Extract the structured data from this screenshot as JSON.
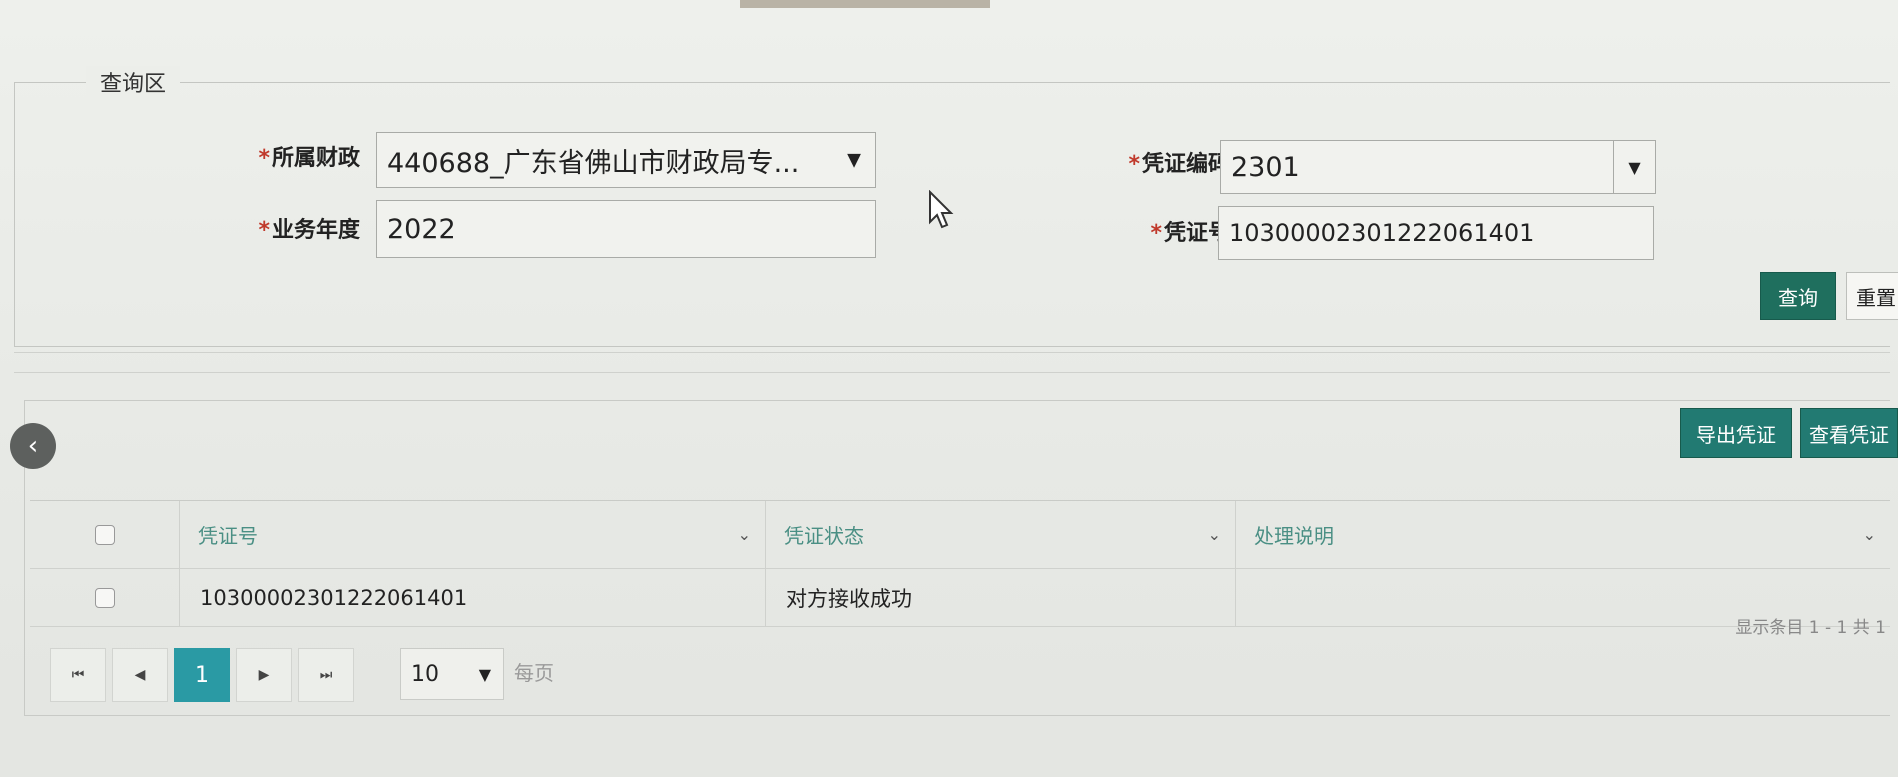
{
  "query_area": {
    "legend": "查询区",
    "fields": {
      "finance": {
        "required": "*",
        "label": "所属财政",
        "value": "440688_广东省佛山市财政局专..."
      },
      "voucher_code": {
        "required": "*",
        "label": "凭证编码",
        "value": "2301"
      },
      "year": {
        "required": "*",
        "label": "业务年度",
        "value": "2022"
      },
      "voucher_no": {
        "required": "*",
        "label": "凭证号",
        "value": "10300002301222061401"
      }
    },
    "buttons": {
      "query": "查询",
      "reset": "重置"
    }
  },
  "toolbar": {
    "export": "导出凭证",
    "view": "查看凭证"
  },
  "nav": {
    "back_icon": "chevron-left-icon",
    "back_glyph": "‹"
  },
  "table": {
    "columns": [
      "凭证号",
      "凭证状态",
      "处理说明"
    ],
    "rows": [
      {
        "voucher_no": "10300002301222061401",
        "status": "对方接收成功",
        "note": ""
      }
    ]
  },
  "pagination": {
    "first": "⏮",
    "prev": "◀",
    "current": "1",
    "next": "▶",
    "last": "⏭",
    "page_size": "10",
    "per_page_label": "每页",
    "summary": "显示条目 1 - 1 共 1"
  }
}
